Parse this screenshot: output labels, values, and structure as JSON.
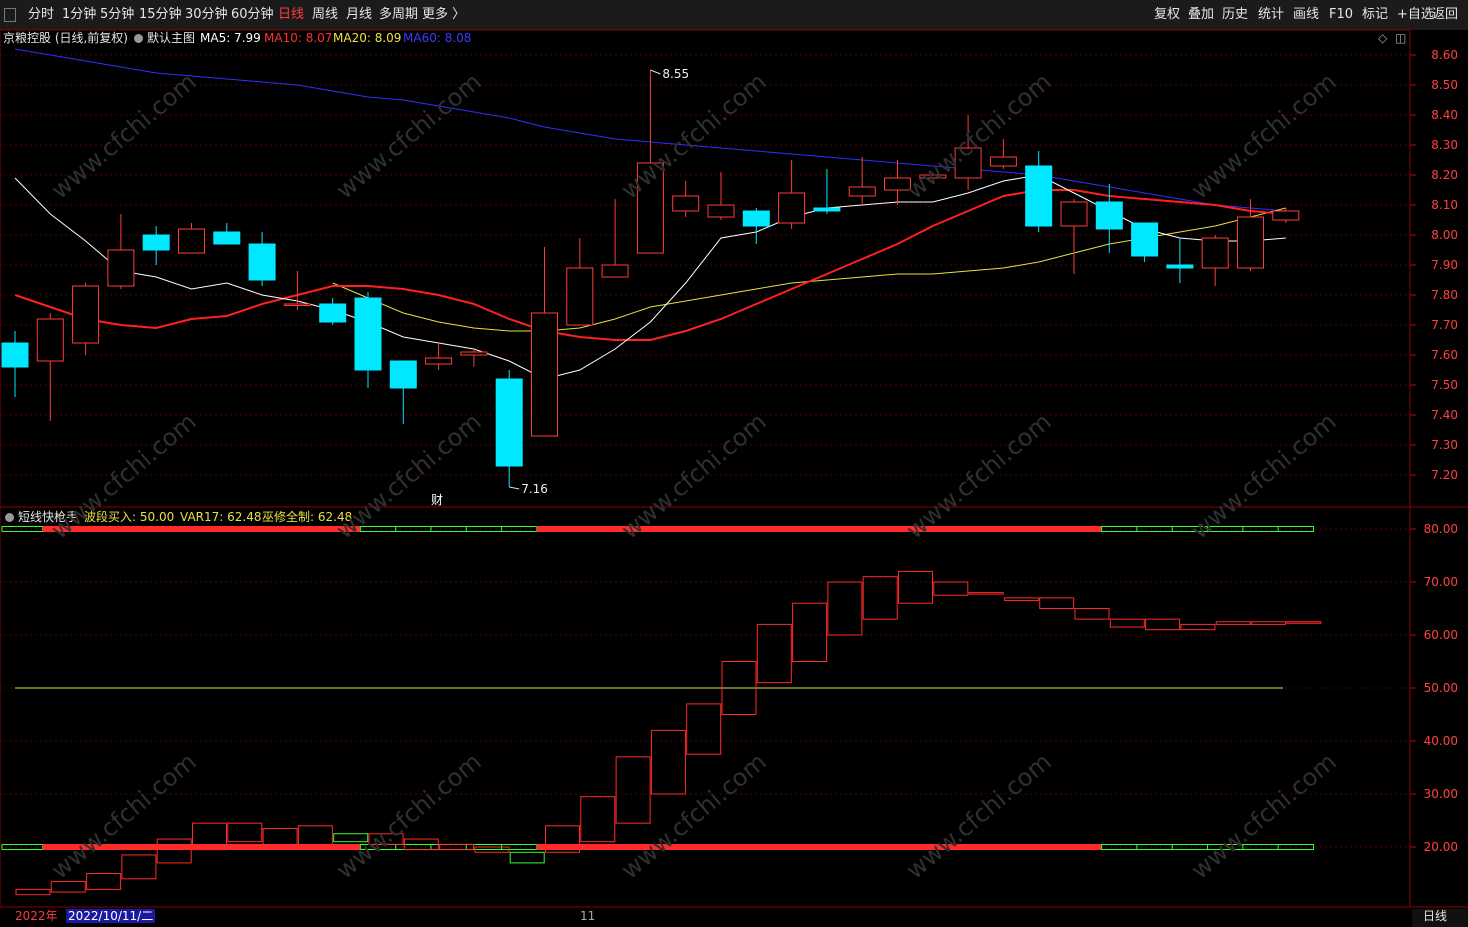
{
  "toolbar": {
    "periods": [
      "分时",
      "1分钟",
      "5分钟",
      "15分钟",
      "30分钟",
      "60分钟",
      "日线",
      "周线",
      "月线",
      "多周期",
      "更多 〉"
    ],
    "active_period": "日线",
    "actions": [
      "复权",
      "叠加",
      "历史",
      "统计",
      "画线",
      "F10",
      "标记",
      "+自选",
      "返回"
    ]
  },
  "main_panel": {
    "title": "京粮控股 (日线,前复权)",
    "template": "默认主图",
    "ma5": "MA5: 7.99",
    "ma10": "MA10: 8.07",
    "ma20": "MA20: 8.09",
    "ma60": "MA60: 8.08",
    "high_label": "8.55",
    "low_label": "7.16",
    "event_marker": "财"
  },
  "indicator_panel": {
    "name": "短线快枪手",
    "buy_line": "波段买入: 50.00",
    "var17": "VAR17: 62.48",
    "control": "巫修全制: 62.48"
  },
  "footer": {
    "year": "2022年",
    "cursor_date": "2022/10/11/二",
    "month_mark": "11",
    "period_label": "日线"
  },
  "colors": {
    "up": "#ff3b3b",
    "down": "#00e8ff",
    "ma5": "#ffffff",
    "ma10": "#ff2020",
    "ma20": "#e8e040",
    "ma60": "#3030ff",
    "indicator_up": "#ff2a2a",
    "indicator_down": "#33ff33",
    "grid": "#5a0000"
  },
  "chart_data": {
    "type": "candlestick",
    "price_axis": {
      "min": 7.15,
      "max": 8.65,
      "ticks": [
        "8.60",
        "8.50",
        "8.40",
        "8.30",
        "8.20",
        "8.10",
        "8.00",
        "7.90",
        "7.80",
        "7.70",
        "7.60",
        "7.50",
        "7.40",
        "7.30",
        "7.20"
      ]
    },
    "candles": [
      [
        7.64,
        7.56,
        7.68,
        7.46
      ],
      [
        7.58,
        7.72,
        7.74,
        7.38
      ],
      [
        7.64,
        7.83,
        7.84,
        7.6
      ],
      [
        7.83,
        7.95,
        8.07,
        7.82
      ],
      [
        8.0,
        7.95,
        8.03,
        7.9
      ],
      [
        7.94,
        8.02,
        8.04,
        7.94
      ],
      [
        8.01,
        7.97,
        8.04,
        7.97
      ],
      [
        7.97,
        7.85,
        8.01,
        7.83
      ],
      [
        7.77,
        7.77,
        7.88,
        7.75
      ],
      [
        7.77,
        7.71,
        7.79,
        7.7
      ],
      [
        7.79,
        7.55,
        7.81,
        7.49
      ],
      [
        7.58,
        7.49,
        7.58,
        7.37
      ],
      [
        7.57,
        7.59,
        7.64,
        7.55
      ],
      [
        7.6,
        7.61,
        7.62,
        7.56
      ],
      [
        7.52,
        7.23,
        7.55,
        7.16
      ],
      [
        7.33,
        7.74,
        7.96,
        7.33
      ],
      [
        7.7,
        7.89,
        7.99,
        7.7
      ],
      [
        7.86,
        7.9,
        8.12,
        7.86
      ],
      [
        7.94,
        8.24,
        8.55,
        7.94
      ],
      [
        8.08,
        8.13,
        8.18,
        8.06
      ],
      [
        8.06,
        8.1,
        8.21,
        8.05
      ],
      [
        8.08,
        8.03,
        8.09,
        7.97
      ],
      [
        8.04,
        8.14,
        8.25,
        8.02
      ],
      [
        8.09,
        8.08,
        8.22,
        8.07
      ],
      [
        8.13,
        8.16,
        8.26,
        8.1
      ],
      [
        8.15,
        8.19,
        8.25,
        8.1
      ],
      [
        8.19,
        8.2,
        8.2,
        8.18
      ],
      [
        8.19,
        8.29,
        8.4,
        8.15
      ],
      [
        8.23,
        8.26,
        8.32,
        8.22
      ],
      [
        8.23,
        8.03,
        8.28,
        8.01
      ],
      [
        8.03,
        8.11,
        8.12,
        7.87
      ],
      [
        8.11,
        8.02,
        8.17,
        7.94
      ],
      [
        8.04,
        7.93,
        8.04,
        7.91
      ],
      [
        7.9,
        7.89,
        7.99,
        7.84
      ],
      [
        7.89,
        7.99,
        8.0,
        7.83
      ],
      [
        7.89,
        8.06,
        8.12,
        7.88
      ],
      [
        8.05,
        8.08,
        8.09,
        8.04
      ]
    ],
    "ma5": [
      8.19,
      8.07,
      7.98,
      7.88,
      7.86,
      7.82,
      7.84,
      7.8,
      7.78,
      7.75,
      7.71,
      7.66,
      7.64,
      7.62,
      7.58,
      7.52,
      7.55,
      7.62,
      7.71,
      7.84,
      7.99,
      8.01,
      8.06,
      8.09,
      8.1,
      8.11,
      8.11,
      8.14,
      8.18,
      8.2,
      8.14,
      8.08,
      8.02,
      7.99,
      7.98,
      7.98,
      7.99
    ],
    "ma10": [
      7.8,
      7.76,
      7.72,
      7.7,
      7.69,
      7.72,
      7.73,
      7.77,
      7.8,
      7.83,
      7.83,
      7.82,
      7.8,
      7.77,
      7.72,
      7.68,
      7.66,
      7.65,
      7.65,
      7.68,
      7.72,
      7.77,
      7.82,
      7.87,
      7.92,
      7.97,
      8.03,
      8.08,
      8.13,
      8.15,
      8.15,
      8.13,
      8.12,
      8.11,
      8.1,
      8.08,
      8.07
    ],
    "ma20": [
      null,
      null,
      null,
      null,
      null,
      null,
      null,
      null,
      null,
      7.84,
      7.79,
      7.74,
      7.71,
      7.69,
      7.68,
      7.68,
      7.69,
      7.72,
      7.76,
      7.78,
      7.8,
      7.82,
      7.84,
      7.85,
      7.86,
      7.87,
      7.87,
      7.88,
      7.89,
      7.91,
      7.94,
      7.97,
      7.99,
      8.01,
      8.03,
      8.06,
      8.09
    ],
    "ma60": [
      8.62,
      8.6,
      8.58,
      8.56,
      8.54,
      8.53,
      8.52,
      8.51,
      8.5,
      8.48,
      8.46,
      8.45,
      8.43,
      8.41,
      8.39,
      8.36,
      8.34,
      8.32,
      8.31,
      8.3,
      8.29,
      8.28,
      8.27,
      8.26,
      8.25,
      8.24,
      8.23,
      8.22,
      8.21,
      8.2,
      8.18,
      8.16,
      8.14,
      8.12,
      8.1,
      8.09,
      8.08
    ],
    "indicator_axis": {
      "min": 10,
      "max": 85,
      "ticks": [
        "80.00",
        "70.00",
        "60.00",
        "50.00",
        "40.00",
        "30.00",
        "20.00"
      ]
    },
    "buy_line_value": 50,
    "indicator_boxes": [
      [
        11,
        12
      ],
      [
        11.5,
        13.5
      ],
      [
        12,
        15
      ],
      [
        14,
        18.5
      ],
      [
        17,
        21.5
      ],
      [
        19.5,
        24.5
      ],
      [
        21,
        24.5
      ],
      [
        20,
        23.5
      ],
      [
        20,
        24
      ],
      [
        22.5,
        21
      ],
      [
        20.5,
        22.5
      ],
      [
        19.5,
        21.5
      ],
      [
        19.5,
        20.5
      ],
      [
        19,
        20
      ],
      [
        19,
        17
      ],
      [
        19,
        24
      ],
      [
        21,
        29.5
      ],
      [
        24.5,
        37
      ],
      [
        30,
        42
      ],
      [
        37.5,
        47
      ],
      [
        45,
        55
      ],
      [
        51,
        62
      ],
      [
        55,
        66
      ],
      [
        60,
        70
      ],
      [
        63,
        71
      ],
      [
        66,
        72
      ],
      [
        67.5,
        70
      ],
      [
        68,
        68
      ],
      [
        66.5,
        67
      ],
      [
        65,
        67
      ],
      [
        63,
        65
      ],
      [
        61.5,
        63
      ],
      [
        61,
        63
      ],
      [
        61,
        62
      ],
      [
        62,
        62.5
      ],
      [
        62,
        62.5
      ],
      [
        62.5,
        62.5
      ]
    ],
    "band_top_value": 80,
    "band_bottom_value": 20,
    "band_segments": [
      {
        "from": 0,
        "to": 0,
        "color": "green"
      },
      {
        "from": 1,
        "to": 9,
        "color": "red"
      },
      {
        "from": 10,
        "to": 14,
        "color": "green"
      },
      {
        "from": 15,
        "to": 30,
        "color": "red"
      },
      {
        "from": 31,
        "to": 36,
        "color": "green"
      }
    ]
  }
}
